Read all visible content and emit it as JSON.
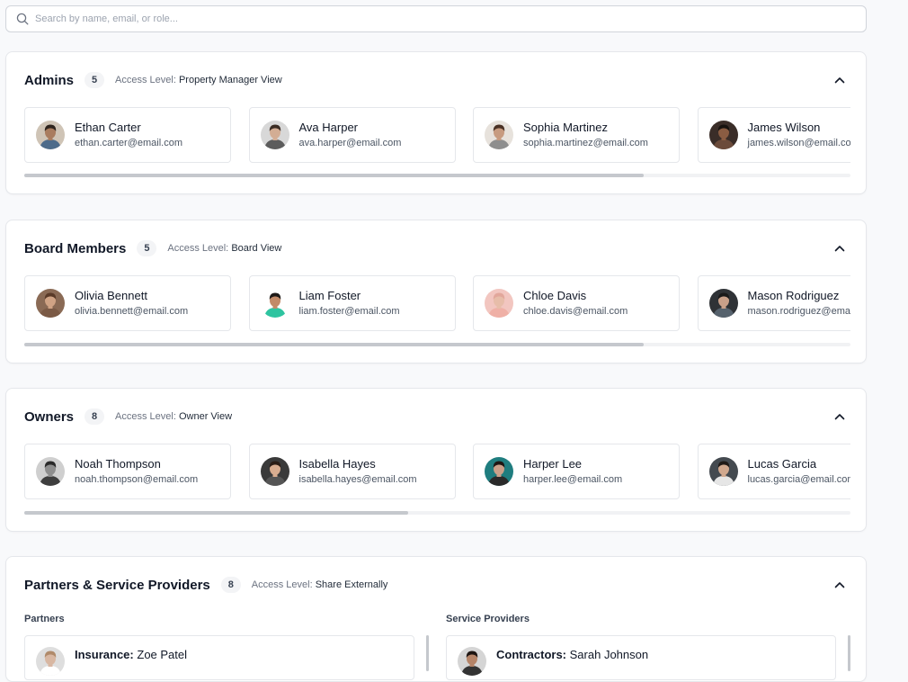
{
  "search": {
    "placeholder": "Search by name, email, or role..."
  },
  "access_label": "Access Level:",
  "sections": [
    {
      "title": "Admins",
      "count": "5",
      "access": "Property Manager View",
      "scroll_fraction": 0.75,
      "members": [
        {
          "name": "Ethan Carter",
          "email": "ethan.carter@email.com",
          "avatar": "photo-man-blue-shirt"
        },
        {
          "name": "Ava Harper",
          "email": "ava.harper@email.com",
          "avatar": "photo-woman-glasses"
        },
        {
          "name": "Sophia Martinez",
          "email": "sophia.martinez@email.com",
          "avatar": "photo-woman-curly-hair"
        },
        {
          "name": "James Wilson",
          "email": "james.wilson@email.com",
          "avatar": "photo-man-dark"
        }
      ]
    },
    {
      "title": "Board Members",
      "count": "5",
      "access": "Board View",
      "scroll_fraction": 0.75,
      "members": [
        {
          "name": "Olivia Bennett",
          "email": "olivia.bennett@email.com",
          "avatar": "photo-woman-brown-hair"
        },
        {
          "name": "Liam Foster",
          "email": "liam.foster@email.com",
          "avatar": "photo-man-green-shirt"
        },
        {
          "name": "Chloe Davis",
          "email": "chloe.davis@email.com",
          "avatar": "photo-woman-pink"
        },
        {
          "name": "Mason Rodriguez",
          "email": "mason.rodriguez@email.com",
          "avatar": "photo-man-dark-hair"
        }
      ]
    },
    {
      "title": "Owners",
      "count": "8",
      "access": "Owner View",
      "scroll_fraction": 0.465,
      "members": [
        {
          "name": "Noah Thompson",
          "email": "noah.thompson@email.com",
          "avatar": "photo-man-bw"
        },
        {
          "name": "Isabella Hayes",
          "email": "isabella.hayes@email.com",
          "avatar": "photo-woman-long-hair"
        },
        {
          "name": "Harper Lee",
          "email": "harper.lee@email.com",
          "avatar": "photo-woman-teal"
        },
        {
          "name": "Lucas Garcia",
          "email": "lucas.garcia@email.com",
          "avatar": "photo-man-white-shirt"
        }
      ]
    }
  ],
  "partners_section": {
    "title": "Partners & Service Providers",
    "count": "8",
    "access": "Share Externally",
    "partners_label": "Partners",
    "providers_label": "Service Providers",
    "partner_first": {
      "type": "Insurance:",
      "name": "Zoe Patel",
      "avatar": "photo-woman-light"
    },
    "provider_first": {
      "type": "Contractors:",
      "name": "Sarah Johnson",
      "avatar": "photo-woman-dark-hair"
    }
  },
  "colors": {
    "accent": "#111827",
    "border": "#e5e7eb",
    "muted": "#6b7280"
  }
}
